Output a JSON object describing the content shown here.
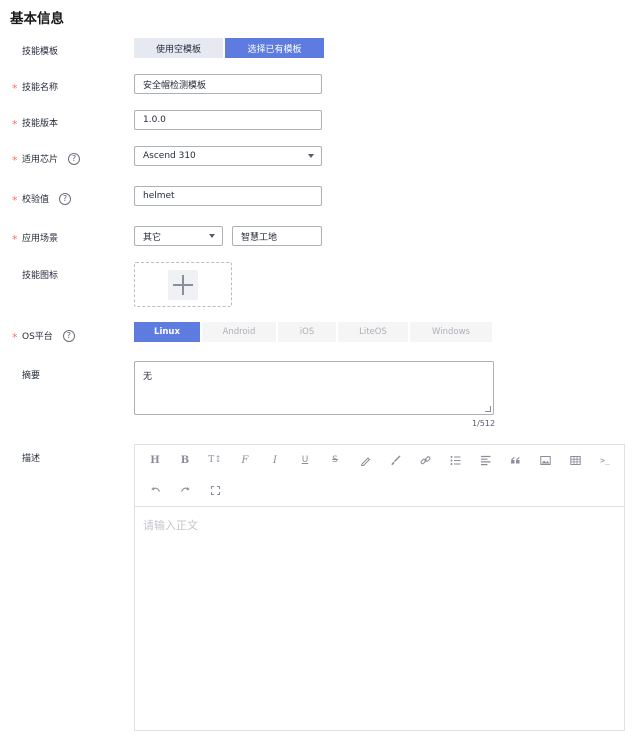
{
  "section": {
    "title": "基本信息"
  },
  "fields": {
    "template": {
      "label": "技能模板",
      "options": [
        "使用空模板",
        "选择已有模板"
      ],
      "selected": "选择已有模板"
    },
    "name": {
      "label": "技能名称",
      "value": "安全帽检测模板"
    },
    "version": {
      "label": "技能版本",
      "value": "1.0.0"
    },
    "chip": {
      "label": "适用芯片",
      "value": "Ascend 310",
      "help": "?"
    },
    "check_value": {
      "label": "校验值",
      "value": "helmet",
      "help": "?"
    },
    "scene": {
      "label": "应用场景",
      "category": "其它",
      "value": "智慧工地"
    },
    "icon": {
      "label": "技能图标"
    },
    "os": {
      "label": "OS平台",
      "help": "?",
      "options": [
        "Linux",
        "Android",
        "iOS",
        "LiteOS",
        "Windows"
      ],
      "selected": "Linux"
    },
    "summary": {
      "label": "摘要",
      "value": "无",
      "counter": "1/512"
    },
    "description": {
      "label": "描述",
      "placeholder": "请输入正文"
    }
  },
  "required_mark": "*",
  "toolbar": {
    "icons": [
      "heading-icon",
      "bold-icon",
      "font-size-icon",
      "font-family-icon",
      "italic-icon",
      "underline-icon",
      "strikethrough-icon",
      "highlight-icon",
      "brush-icon",
      "link-icon",
      "bullet-list-icon",
      "align-icon",
      "quote-icon",
      "image-icon",
      "table-icon",
      "code-icon",
      "undo-icon",
      "redo-icon",
      "fullscreen-icon"
    ],
    "glyphs": {
      "heading": "H",
      "bold": "B",
      "font_size": "T↕",
      "font_family": "F",
      "italic": "I",
      "underline": "U",
      "strike": "S",
      "code": ">_"
    }
  },
  "colors": {
    "primary": "#5e7ce0",
    "required": "#f66f6a",
    "border": "#adb0b8"
  }
}
